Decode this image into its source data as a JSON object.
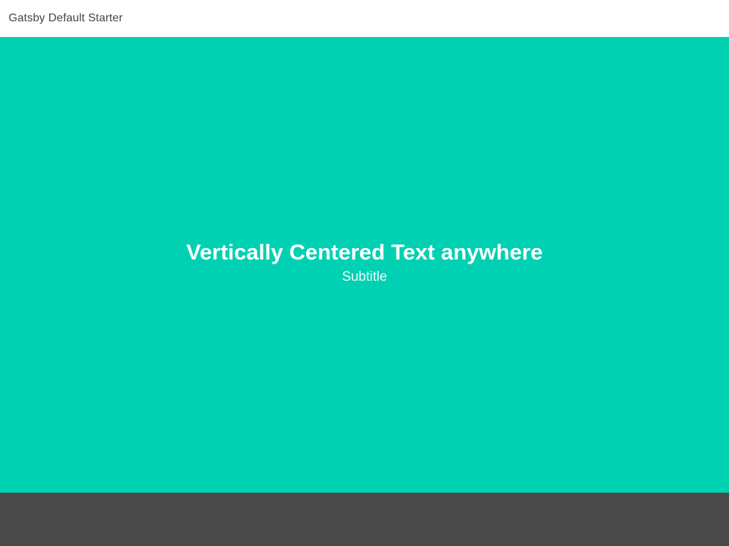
{
  "header": {
    "site_title": "Gatsby Default Starter"
  },
  "hero": {
    "title": "Vertically Centered Text anywhere",
    "subtitle": "Subtitle"
  },
  "colors": {
    "header_bg": "#ffffff",
    "hero_bg": "#00d1b2",
    "footer_bg": "#4a4a4a",
    "header_text": "#444444",
    "hero_text": "#ffffff"
  }
}
